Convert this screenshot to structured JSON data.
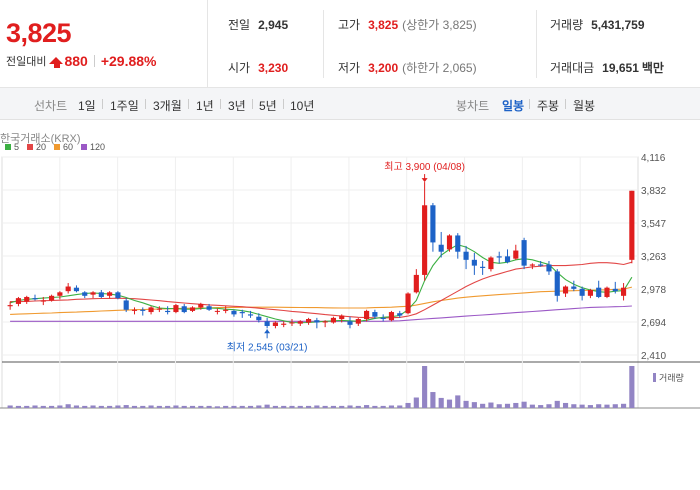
{
  "summary": {
    "current_price": "3,825",
    "change_label": "전일대비",
    "change_amount": "880",
    "change_percent": "+29.88%",
    "prev_close": {
      "label": "전일",
      "value": "2,945"
    },
    "open": {
      "label": "시가",
      "value": "3,230"
    },
    "high": {
      "label": "고가",
      "value": "3,825",
      "note": "(상한가 3,825)"
    },
    "low": {
      "label": "저가",
      "value": "3,200",
      "note": "(하한가 2,065)"
    },
    "volume": {
      "label": "거래량",
      "value": "5,431,759"
    },
    "turnover": {
      "label": "거래대금",
      "value": "19,651",
      "unit": "백만"
    }
  },
  "line_chart_tabs": {
    "label": "선차트",
    "items": [
      "1일",
      "1주일",
      "3개월",
      "1년",
      "3년",
      "5년",
      "10년"
    ]
  },
  "candle_chart_tabs": {
    "label": "봉차트",
    "items": [
      "일봉",
      "주봉",
      "월봉"
    ],
    "active": "일봉"
  },
  "colors": {
    "up": "#e01e1e",
    "down": "#1d62c7",
    "ma5": "#3cb043",
    "ma20": "#e24646",
    "ma60": "#f09a30",
    "ma120": "#9b59c6",
    "volume": "#9284c4"
  },
  "chart_data": {
    "type": "candlestick",
    "source": "한국거래소(KRX)",
    "moving_averages": [
      {
        "name": "5",
        "color": "#3cb043"
      },
      {
        "name": "20",
        "color": "#e24646"
      },
      {
        "name": "60",
        "color": "#f09a30"
      },
      {
        "name": "120",
        "color": "#9b59c6"
      }
    ],
    "y_ticks": [
      "4,116",
      "3,832",
      "3,547",
      "3,263",
      "2,978",
      "2,694",
      "2,410"
    ],
    "ylim": [
      2410,
      4116
    ],
    "max_annotation": "최고 3,900 (04/08)",
    "min_annotation": "최저 2,545 (03/21)",
    "volume_label": "거래량",
    "candles": [
      [
        2830,
        2870,
        2800,
        2840
      ],
      [
        2850,
        2910,
        2830,
        2900
      ],
      [
        2870,
        2920,
        2850,
        2910
      ],
      [
        2900,
        2930,
        2880,
        2890
      ],
      [
        2870,
        2910,
        2840,
        2880
      ],
      [
        2880,
        2930,
        2870,
        2920
      ],
      [
        2920,
        2960,
        2890,
        2950
      ],
      [
        2960,
        3030,
        2940,
        3000
      ],
      [
        2990,
        3010,
        2950,
        2960
      ],
      [
        2950,
        2960,
        2900,
        2920
      ],
      [
        2930,
        2960,
        2900,
        2950
      ],
      [
        2950,
        2970,
        2900,
        2910
      ],
      [
        2920,
        2960,
        2900,
        2950
      ],
      [
        2950,
        2960,
        2890,
        2900
      ],
      [
        2880,
        2900,
        2780,
        2800
      ],
      [
        2790,
        2820,
        2760,
        2800
      ],
      [
        2800,
        2820,
        2750,
        2790
      ],
      [
        2780,
        2830,
        2760,
        2820
      ],
      [
        2800,
        2830,
        2780,
        2810
      ],
      [
        2790,
        2830,
        2760,
        2780
      ],
      [
        2780,
        2850,
        2770,
        2840
      ],
      [
        2830,
        2850,
        2770,
        2780
      ],
      [
        2790,
        2830,
        2780,
        2820
      ],
      [
        2820,
        2860,
        2800,
        2850
      ],
      [
        2830,
        2850,
        2790,
        2800
      ],
      [
        2790,
        2810,
        2760,
        2790
      ],
      [
        2790,
        2830,
        2770,
        2800
      ],
      [
        2790,
        2800,
        2740,
        2760
      ],
      [
        2780,
        2800,
        2730,
        2770
      ],
      [
        2760,
        2790,
        2730,
        2750
      ],
      [
        2740,
        2770,
        2690,
        2710
      ],
      [
        2700,
        2730,
        2640,
        2660
      ],
      [
        2660,
        2700,
        2640,
        2690
      ],
      [
        2670,
        2700,
        2650,
        2680
      ],
      [
        2690,
        2720,
        2660,
        2690
      ],
      [
        2680,
        2710,
        2660,
        2700
      ],
      [
        2690,
        2730,
        2670,
        2720
      ],
      [
        2710,
        2730,
        2640,
        2690
      ],
      [
        2690,
        2710,
        2650,
        2700
      ],
      [
        2690,
        2740,
        2680,
        2730
      ],
      [
        2720,
        2760,
        2690,
        2750
      ],
      [
        2700,
        2740,
        2640,
        2670
      ],
      [
        2680,
        2730,
        2660,
        2720
      ],
      [
        2720,
        2800,
        2700,
        2790
      ],
      [
        2780,
        2800,
        2720,
        2740
      ],
      [
        2730,
        2760,
        2700,
        2720
      ],
      [
        2710,
        2790,
        2700,
        2780
      ],
      [
        2770,
        2790,
        2730,
        2750
      ],
      [
        2770,
        2950,
        2760,
        2940
      ],
      [
        2950,
        3150,
        2940,
        3100
      ],
      [
        3100,
        3900,
        3050,
        3700
      ],
      [
        3700,
        3720,
        3300,
        3380
      ],
      [
        3360,
        3470,
        3250,
        3300
      ],
      [
        3320,
        3450,
        3300,
        3440
      ],
      [
        3440,
        3460,
        3240,
        3300
      ],
      [
        3300,
        3350,
        3150,
        3230
      ],
      [
        3230,
        3290,
        3100,
        3180
      ],
      [
        3170,
        3220,
        3100,
        3160
      ],
      [
        3150,
        3260,
        3130,
        3250
      ],
      [
        3260,
        3300,
        3200,
        3250
      ],
      [
        3260,
        3320,
        3200,
        3210
      ],
      [
        3240,
        3360,
        3230,
        3310
      ],
      [
        3400,
        3420,
        3150,
        3180
      ],
      [
        3180,
        3200,
        3150,
        3190
      ],
      [
        3190,
        3220,
        3170,
        3180
      ],
      [
        3190,
        3220,
        3100,
        3130
      ],
      [
        3130,
        3150,
        2870,
        2920
      ],
      [
        2940,
        3010,
        2910,
        3000
      ],
      [
        3000,
        3050,
        2960,
        2980
      ],
      [
        2980,
        3000,
        2880,
        2920
      ],
      [
        2920,
        2980,
        2900,
        2970
      ],
      [
        2990,
        3050,
        2900,
        2910
      ],
      [
        2910,
        3000,
        2900,
        2990
      ],
      [
        2980,
        3040,
        2940,
        2960
      ],
      [
        2920,
        3030,
        2880,
        2990
      ],
      [
        3230,
        3825,
        3200,
        3825
      ]
    ],
    "ma5": [
      2860,
      2880,
      2890,
      2895,
      2900,
      2905,
      2910,
      2920,
      2930,
      2940,
      2945,
      2940,
      2935,
      2925,
      2905,
      2880,
      2860,
      2835,
      2815,
      2810,
      2810,
      2805,
      2805,
      2810,
      2815,
      2812,
      2805,
      2800,
      2792,
      2780,
      2760,
      2740,
      2720,
      2705,
      2690,
      2688,
      2690,
      2695,
      2700,
      2705,
      2708,
      2705,
      2700,
      2710,
      2725,
      2735,
      2740,
      2750,
      2800,
      2880,
      3050,
      3180,
      3270,
      3320,
      3360,
      3340,
      3300,
      3250,
      3210,
      3200,
      3210,
      3230,
      3240,
      3230,
      3210,
      3190,
      3120,
      3060,
      3020,
      2990,
      2970,
      2955,
      2950,
      2960,
      2965,
      3080
    ],
    "ma20": [
      2870,
      2870,
      2872,
      2875,
      2878,
      2880,
      2882,
      2885,
      2890,
      2892,
      2895,
      2897,
      2898,
      2899,
      2898,
      2895,
      2890,
      2884,
      2878,
      2870,
      2864,
      2858,
      2852,
      2847,
      2842,
      2838,
      2834,
      2830,
      2826,
      2820,
      2813,
      2806,
      2800,
      2793,
      2786,
      2780,
      2773,
      2766,
      2758,
      2752,
      2746,
      2740,
      2735,
      2732,
      2730,
      2730,
      2731,
      2734,
      2745,
      2765,
      2800,
      2840,
      2880,
      2920,
      2960,
      3000,
      3035,
      3065,
      3090,
      3110,
      3130,
      3150,
      3160,
      3170,
      3175,
      3180,
      3180,
      3180,
      3185,
      3190,
      3200,
      3205,
      3205,
      3200,
      3190,
      3210
    ],
    "ma60": [
      2760,
      2762,
      2765,
      2768,
      2770,
      2772,
      2775,
      2778,
      2780,
      2783,
      2786,
      2789,
      2792,
      2795,
      2797,
      2800,
      2802,
      2804,
      2806,
      2808,
      2810,
      2812,
      2813,
      2815,
      2816,
      2818,
      2819,
      2820,
      2821,
      2822,
      2822,
      2822,
      2822,
      2821,
      2820,
      2819,
      2818,
      2818,
      2817,
      2816,
      2815,
      2815,
      2815,
      2816,
      2818,
      2820,
      2822,
      2826,
      2830,
      2840,
      2855,
      2868,
      2880,
      2890,
      2900,
      2908,
      2915,
      2920,
      2925,
      2930,
      2935,
      2940,
      2945,
      2950,
      2955,
      2958,
      2960,
      2962,
      2964,
      2966,
      2968,
      2970,
      2972,
      2975,
      2978,
      2995
    ],
    "ma120": [
      2700,
      2700,
      2700,
      2700,
      2700,
      2700,
      2700,
      2700,
      2700,
      2700,
      2700,
      2700,
      2700,
      2700,
      2700,
      2700,
      2700,
      2700,
      2700,
      2700,
      2700,
      2700,
      2700,
      2700,
      2700,
      2700,
      2700,
      2700,
      2700,
      2700,
      2700,
      2700,
      2700,
      2700,
      2700,
      2700,
      2700,
      2700,
      2700,
      2700,
      2700,
      2700,
      2700,
      2700,
      2700,
      2700,
      2702,
      2705,
      2710,
      2715,
      2720,
      2725,
      2730,
      2735,
      2740,
      2745,
      2750,
      2755,
      2760,
      2765,
      2770,
      2775,
      2780,
      2785,
      2790,
      2795,
      2800,
      2805,
      2810,
      2815,
      2820,
      2822,
      2824,
      2826,
      2828,
      2832
    ],
    "volume": [
      0.06,
      0.05,
      0.05,
      0.06,
      0.05,
      0.05,
      0.06,
      0.09,
      0.06,
      0.05,
      0.06,
      0.05,
      0.05,
      0.06,
      0.07,
      0.05,
      0.05,
      0.06,
      0.05,
      0.05,
      0.06,
      0.05,
      0.05,
      0.05,
      0.05,
      0.04,
      0.05,
      0.05,
      0.05,
      0.05,
      0.06,
      0.08,
      0.05,
      0.05,
      0.05,
      0.05,
      0.05,
      0.06,
      0.05,
      0.05,
      0.05,
      0.06,
      0.05,
      0.07,
      0.05,
      0.05,
      0.06,
      0.06,
      0.12,
      0.25,
      1.0,
      0.38,
      0.24,
      0.2,
      0.3,
      0.17,
      0.14,
      0.1,
      0.13,
      0.09,
      0.1,
      0.12,
      0.15,
      0.08,
      0.07,
      0.09,
      0.17,
      0.12,
      0.09,
      0.08,
      0.07,
      0.09,
      0.08,
      0.09,
      0.1,
      1.0
    ]
  }
}
